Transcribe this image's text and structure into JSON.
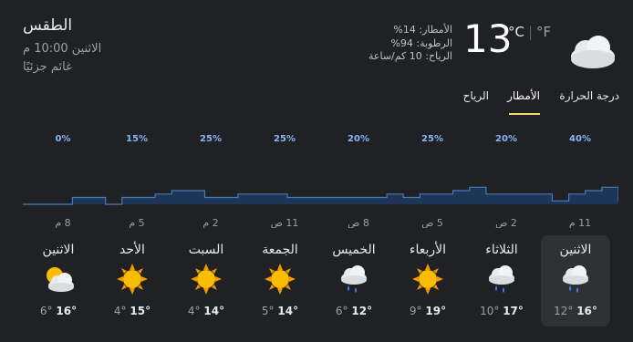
{
  "title": "الطقس",
  "datetime": "الاثنين 10:00 م",
  "condition": "غائم جزئيًا",
  "current": {
    "temp": "13",
    "unit_c": "°C",
    "unit_sep": "|",
    "unit_f": "°F",
    "icon": "moon-cloud-icon"
  },
  "stats": {
    "precip": "الأمطار: 14%",
    "humidity": "الرطوبة: 94%",
    "wind": "الرياح: 10 كم/ساعة"
  },
  "tabs": [
    {
      "label": "درجة الحرارة"
    },
    {
      "label": "الأمطار",
      "active": true
    },
    {
      "label": "الرياح"
    }
  ],
  "chart_data": {
    "type": "area",
    "series_label": "Precipitation",
    "top_labels": [
      "0%",
      "15%",
      "25%",
      "25%",
      "20%",
      "25%",
      "20%",
      "40%"
    ],
    "x_labels": [
      "8 م",
      "5 م",
      "2 م",
      "11 ص",
      "8 ص",
      "5 ص",
      "2 ص",
      "11 م"
    ],
    "values": [
      0,
      0,
      0,
      10,
      10,
      0,
      10,
      10,
      15,
      20,
      20,
      10,
      10,
      15,
      15,
      15,
      10,
      10,
      10,
      10,
      10,
      10,
      15,
      10,
      15,
      15,
      20,
      25,
      15,
      15,
      15,
      15,
      5,
      15,
      20,
      25,
      5
    ],
    "ylim": [
      0,
      100
    ],
    "colors": {
      "fill": "#1f3557",
      "line": "#4a7ab8",
      "label": "#8ab4f8"
    }
  },
  "days": [
    {
      "name": "الاثنين",
      "icon": "partly-cloudy-icon",
      "low": "6°",
      "high": "16°"
    },
    {
      "name": "الأحد",
      "icon": "sun-icon",
      "low": "4°",
      "high": "15°"
    },
    {
      "name": "السبت",
      "icon": "sun-icon",
      "low": "4°",
      "high": "14°"
    },
    {
      "name": "الجمعة",
      "icon": "sun-icon",
      "low": "5°",
      "high": "14°"
    },
    {
      "name": "الخميس",
      "icon": "rain-cloud-icon",
      "low": "6°",
      "high": "12°"
    },
    {
      "name": "الأربعاء",
      "icon": "sun-icon",
      "low": "9°",
      "high": "19°"
    },
    {
      "name": "الثلاثاء",
      "icon": "rain-cloud-icon",
      "low": "10°",
      "high": "17°"
    },
    {
      "name": "الاثنين",
      "icon": "rain-cloud-icon",
      "low": "12°",
      "high": "16°",
      "selected": true
    }
  ]
}
